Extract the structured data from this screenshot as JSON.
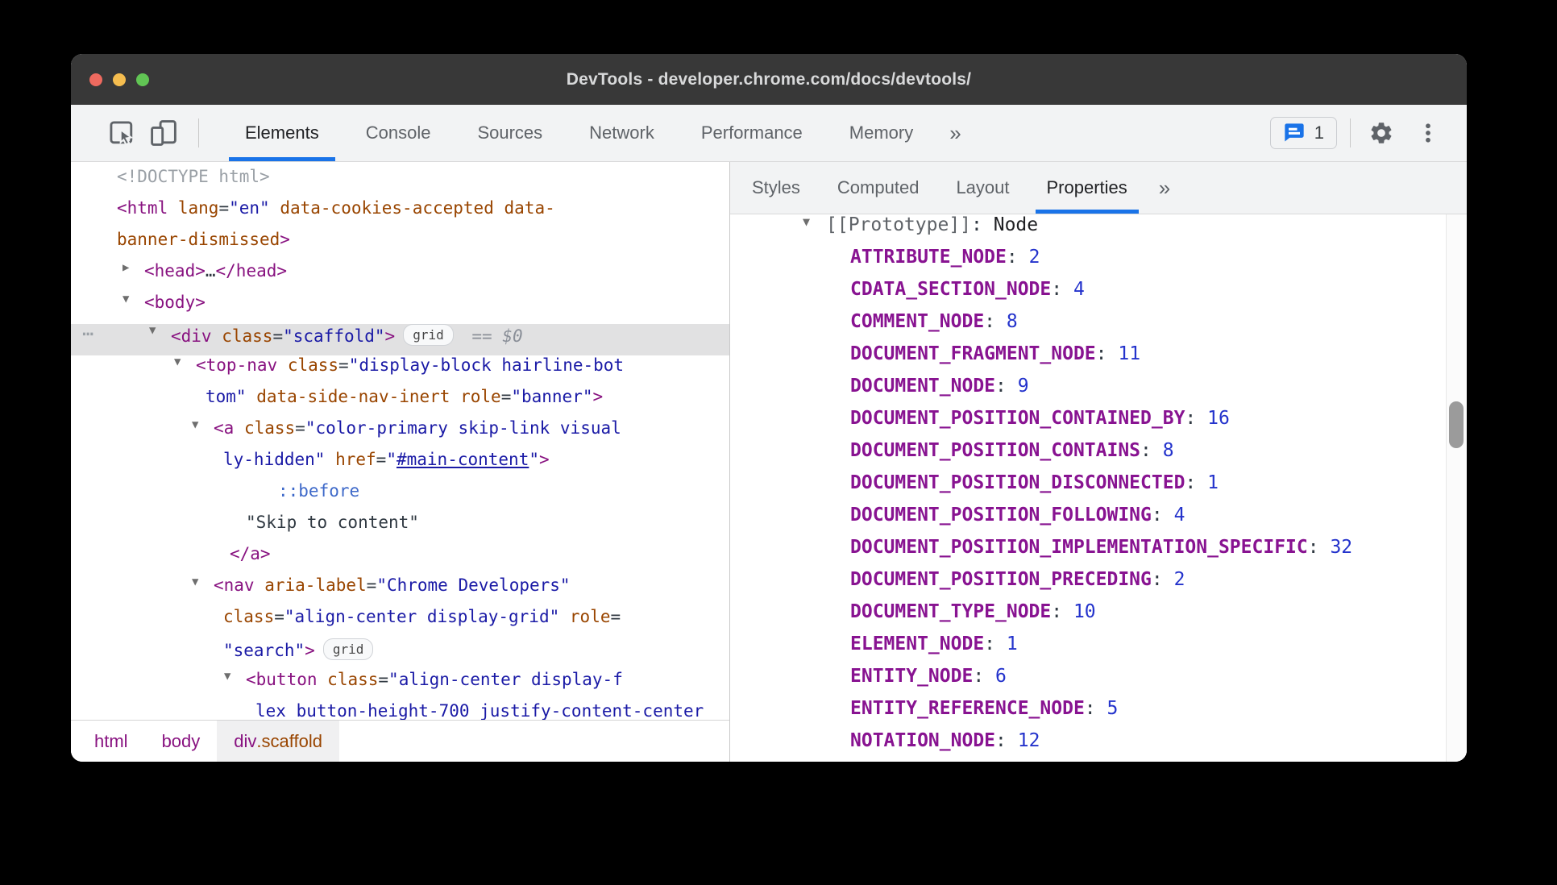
{
  "colors": {
    "accent": "#1a73e8",
    "tag_purple": "#881280",
    "attr_orange": "#994500",
    "value_blue": "#1a1aa6",
    "property_purple": "#881391",
    "number_blue": "#2433cc",
    "selection_gray": "#e1e1e2",
    "issues_bubble_blue": "#1a73e8",
    "traffic_lights": [
      "#ee6a5f",
      "#f5bd4f",
      "#61c554"
    ]
  },
  "window": {
    "title": "DevTools - developer.chrome.com/docs/devtools/"
  },
  "toolbar": {
    "icons": [
      "inspect-element",
      "toggle-device-toolbar"
    ],
    "tabs": [
      {
        "label": "Elements",
        "active": true
      },
      {
        "label": "Console"
      },
      {
        "label": "Sources"
      },
      {
        "label": "Network"
      },
      {
        "label": "Performance"
      },
      {
        "label": "Memory"
      }
    ],
    "more_tabs_label": "»",
    "issues": {
      "count": "1"
    },
    "right_icons": [
      "settings-gear",
      "customize-kebab"
    ]
  },
  "sidebar": {
    "tabs": [
      {
        "label": "Styles"
      },
      {
        "label": "Computed"
      },
      {
        "label": "Layout"
      },
      {
        "label": "Properties",
        "active": true
      }
    ],
    "more_tabs_label": "»",
    "properties": {
      "prototype": {
        "label": "[[Prototype]]",
        "colon": ": ",
        "value": "Node"
      },
      "constants": [
        {
          "n": "ATTRIBUTE_NODE",
          "v": "2"
        },
        {
          "n": "CDATA_SECTION_NODE",
          "v": "4"
        },
        {
          "n": "COMMENT_NODE",
          "v": "8"
        },
        {
          "n": "DOCUMENT_FRAGMENT_NODE",
          "v": "11"
        },
        {
          "n": "DOCUMENT_NODE",
          "v": "9"
        },
        {
          "n": "DOCUMENT_POSITION_CONTAINED_BY",
          "v": "16"
        },
        {
          "n": "DOCUMENT_POSITION_CONTAINS",
          "v": "8"
        },
        {
          "n": "DOCUMENT_POSITION_DISCONNECTED",
          "v": "1"
        },
        {
          "n": "DOCUMENT_POSITION_FOLLOWING",
          "v": "4"
        },
        {
          "n": "DOCUMENT_POSITION_IMPLEMENTATION_SPECIFIC",
          "v": "32"
        },
        {
          "n": "DOCUMENT_POSITION_PRECEDING",
          "v": "2"
        },
        {
          "n": "DOCUMENT_TYPE_NODE",
          "v": "10"
        },
        {
          "n": "ELEMENT_NODE",
          "v": "1"
        },
        {
          "n": "ENTITY_NODE",
          "v": "6"
        },
        {
          "n": "ENTITY_REFERENCE_NODE",
          "v": "5"
        },
        {
          "n": "NOTATION_NODE",
          "v": "12"
        }
      ]
    }
  },
  "dom_tree": {
    "arrows": {
      "d": "▼",
      "r": "▶"
    },
    "dots_glyph": "⋯",
    "lines": [
      {
        "ind": 57,
        "seg": [
          [
            "<!DOCTYPE html>",
            "gy"
          ]
        ]
      },
      {
        "ind": 57,
        "seg": [
          [
            "<html",
            "tg"
          ],
          [
            " ",
            "pl"
          ],
          [
            "lang",
            "at"
          ],
          [
            "=",
            "pl"
          ],
          [
            "\"en\"",
            "vl"
          ],
          [
            " ",
            "pl"
          ],
          [
            "data-cookies-accepted",
            "at"
          ],
          [
            " ",
            "pl"
          ],
          [
            "data-",
            "at"
          ]
        ]
      },
      {
        "ind": 57,
        "seg": [
          [
            "banner-dismissed",
            "at"
          ],
          [
            ">",
            "tg"
          ]
        ]
      },
      {
        "ind": 91,
        "arrow": "r",
        "seg": [
          [
            "<head>",
            "tg"
          ],
          [
            "…",
            "pl"
          ],
          [
            "</head>",
            "tg"
          ]
        ]
      },
      {
        "ind": 91,
        "arrow": "d",
        "seg": [
          [
            "<body>",
            "tg"
          ]
        ]
      },
      {
        "ind": 124,
        "arrow": "d",
        "sel": true,
        "dots": true,
        "seg": [
          [
            "<div",
            "tg"
          ],
          [
            " ",
            "pl"
          ],
          [
            "class",
            "at"
          ],
          [
            "=",
            "pl"
          ],
          [
            "\"scaffold\"",
            "vl"
          ],
          [
            ">",
            "tg"
          ],
          [
            "grid",
            "bd"
          ],
          [
            " == ",
            "eq"
          ],
          [
            "$0",
            "dl"
          ]
        ]
      },
      {
        "ind": 155,
        "arrow": "d",
        "seg": [
          [
            "<top-nav",
            "tg"
          ],
          [
            " ",
            "pl"
          ],
          [
            "class",
            "at"
          ],
          [
            "=",
            "pl"
          ],
          [
            "\"display-block hairline-bot",
            "vl"
          ]
        ]
      },
      {
        "ind": 167,
        "seg": [
          [
            "tom\"",
            "vl"
          ],
          [
            " ",
            "pl"
          ],
          [
            "data-side-nav-inert",
            "at"
          ],
          [
            " ",
            "pl"
          ],
          [
            "role",
            "at"
          ],
          [
            "=",
            "pl"
          ],
          [
            "\"banner\"",
            "vl"
          ],
          [
            ">",
            "tg"
          ]
        ]
      },
      {
        "ind": 177,
        "arrow": "d",
        "seg": [
          [
            "<a",
            "tg"
          ],
          [
            " ",
            "pl"
          ],
          [
            "class",
            "at"
          ],
          [
            "=",
            "pl"
          ],
          [
            "\"color-primary skip-link visual",
            "vl"
          ]
        ]
      },
      {
        "ind": 189,
        "seg": [
          [
            "ly-hidden\"",
            "vl"
          ],
          [
            " ",
            "pl"
          ],
          [
            "href",
            "at"
          ],
          [
            "=",
            "pl"
          ],
          [
            "\"",
            "vl"
          ],
          [
            "#main-content",
            "lk"
          ],
          [
            "\"",
            "vl"
          ],
          [
            ">",
            "tg"
          ]
        ]
      },
      {
        "ind": 257,
        "seg": [
          [
            "::before",
            "ps"
          ]
        ]
      },
      {
        "ind": 217,
        "seg": [
          [
            "\"Skip to content\"",
            "tx"
          ]
        ]
      },
      {
        "ind": 197,
        "seg": [
          [
            "</a>",
            "tg"
          ]
        ]
      },
      {
        "ind": 177,
        "arrow": "d",
        "seg": [
          [
            "<nav",
            "tg"
          ],
          [
            " ",
            "pl"
          ],
          [
            "aria-label",
            "at"
          ],
          [
            "=",
            "pl"
          ],
          [
            "\"Chrome Developers\"",
            "vl"
          ]
        ]
      },
      {
        "ind": 189,
        "seg": [
          [
            "class",
            "at"
          ],
          [
            "=",
            "pl"
          ],
          [
            "\"align-center display-grid\"",
            "vl"
          ],
          [
            " ",
            "pl"
          ],
          [
            "role",
            "at"
          ],
          [
            "=",
            "pl"
          ]
        ]
      },
      {
        "ind": 189,
        "seg": [
          [
            "\"search\"",
            "vl"
          ],
          [
            ">",
            "tg"
          ],
          [
            "grid",
            "bd"
          ]
        ]
      },
      {
        "ind": 217,
        "arrow": "d",
        "seg": [
          [
            "<button",
            "tg"
          ],
          [
            " ",
            "pl"
          ],
          [
            "class",
            "at"
          ],
          [
            "=",
            "pl"
          ],
          [
            "\"align-center display-f",
            "vl"
          ]
        ]
      },
      {
        "ind": 229,
        "seg": [
          [
            "lex button-height-700 justify-content-center",
            "vl"
          ]
        ]
      }
    ]
  },
  "breadcrumbs": [
    {
      "parts": [
        [
          "html",
          "c-tag"
        ]
      ]
    },
    {
      "parts": [
        [
          "body",
          "c-tag"
        ]
      ]
    },
    {
      "parts": [
        [
          "div",
          "c-tag"
        ],
        [
          ".scaffold",
          "c-cls"
        ]
      ],
      "selected": true
    }
  ]
}
